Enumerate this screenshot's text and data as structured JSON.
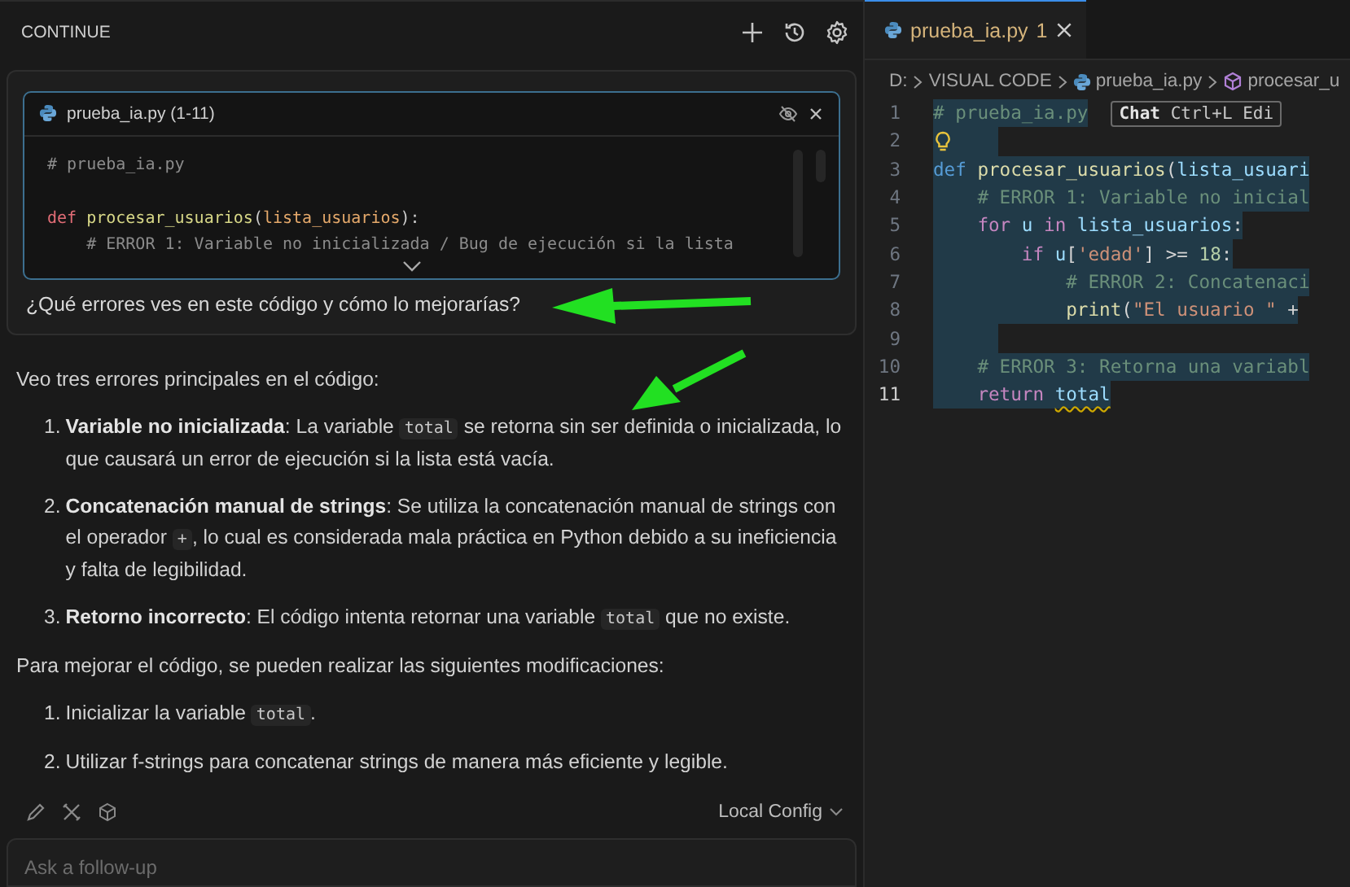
{
  "panel": {
    "title": "CONTINUE"
  },
  "context_card": {
    "file_label": "prueba_ia.py (1-11)",
    "code_lines": [
      {
        "kind": "code",
        "tokens": [
          {
            "kind": "comment",
            "text": "# prueba_ia.py"
          }
        ]
      },
      {
        "kind": "blank"
      },
      {
        "kind": "code",
        "tokens": [
          {
            "kind": "keyword",
            "text": "def"
          },
          {
            "kind": "function",
            "text": " procesar_usuarios"
          },
          {
            "kind": "plain",
            "text": "("
          },
          {
            "kind": "param",
            "text": "lista_usuarios"
          },
          {
            "kind": "plain",
            "text": "):"
          }
        ]
      },
      {
        "kind": "code",
        "tokens": [
          {
            "kind": "comment",
            "text": "    # ERROR 1: Variable no inicializada / Bug de ejecución si la lista"
          }
        ]
      }
    ],
    "question": "¿Qué errores ves en este código y cómo lo mejorarías?"
  },
  "response": [
    {
      "kind": "paragraph",
      "segments": [
        {
          "kind": "text",
          "text": "Veo tres errores principales en el código:"
        }
      ]
    },
    {
      "kind": "list",
      "items": [
        {
          "number": "1.",
          "segments": [
            {
              "kind": "bold",
              "text": "Variable no inicializada"
            },
            {
              "kind": "text",
              "text": ": La variable "
            },
            {
              "kind": "code",
              "text": "total"
            },
            {
              "kind": "text",
              "text": " se retorna sin ser definida o inicializada, lo que causará un error de ejecución si la lista está vacía."
            }
          ]
        },
        {
          "number": "2.",
          "segments": [
            {
              "kind": "bold",
              "text": "Concatenación manual de strings"
            },
            {
              "kind": "text",
              "text": ": Se utiliza la concatenación manual de strings con el operador "
            },
            {
              "kind": "code",
              "text": "+"
            },
            {
              "kind": "text",
              "text": ", lo cual es considerada mala práctica en Python debido a su ineficiencia y falta de legibilidad."
            }
          ]
        },
        {
          "number": "3.",
          "segments": [
            {
              "kind": "bold",
              "text": "Retorno incorrecto"
            },
            {
              "kind": "text",
              "text": ": El código intenta retornar una variable "
            },
            {
              "kind": "code",
              "text": "total"
            },
            {
              "kind": "text",
              "text": " que no existe."
            }
          ]
        }
      ]
    },
    {
      "kind": "paragraph",
      "segments": [
        {
          "kind": "text",
          "text": "Para mejorar el código, se pueden realizar las siguientes modificaciones:"
        }
      ]
    },
    {
      "kind": "list",
      "items": [
        {
          "number": "1.",
          "segments": [
            {
              "kind": "text",
              "text": "Inicializar la variable "
            },
            {
              "kind": "code",
              "text": "total"
            },
            {
              "kind": "text",
              "text": "."
            }
          ]
        },
        {
          "number": "2.",
          "segments": [
            {
              "kind": "text",
              "text": "Utilizar f-strings para concatenar strings de manera más eficiente y legible."
            }
          ]
        }
      ]
    }
  ],
  "footer": {
    "model_selector": "Local Config"
  },
  "follow_up": {
    "placeholder": "Ask a follow-up"
  },
  "editor": {
    "tab": {
      "filename": "prueba_ia.py",
      "problems": "1",
      "selected": true
    },
    "breadcrumb": [
      "D:",
      "VISUAL CODE",
      "prueba_ia.py",
      "procesar_u"
    ],
    "inline_hint": "**Chat** Ctrl+L Edi",
    "lines": [
      {
        "number": "1",
        "current": false,
        "selected": true,
        "tokens": [
          {
            "kind": "comment",
            "text": "# prueba_ia.py"
          }
        ]
      },
      {
        "number": "2",
        "current": false,
        "selected": true
      },
      {
        "number": "3",
        "current": false,
        "selected": true,
        "tokens": [
          {
            "kind": "keyword",
            "text": "def"
          },
          {
            "kind": "function",
            "text": " procesar_usuarios"
          },
          {
            "kind": "plain",
            "text": "("
          },
          {
            "kind": "param",
            "text": "lista_usuari"
          }
        ]
      },
      {
        "number": "4",
        "current": false,
        "selected": true,
        "tokens": [
          {
            "kind": "comment",
            "text": "    # ERROR 1: Variable no inicial"
          }
        ]
      },
      {
        "number": "5",
        "current": false,
        "selected": true,
        "tokens": [
          {
            "kind": "control",
            "text": "    for"
          },
          {
            "kind": "param",
            "text": " u"
          },
          {
            "kind": "control",
            "text": " in"
          },
          {
            "kind": "param",
            "text": " lista_usuarios"
          },
          {
            "kind": "plain",
            "text": ":"
          }
        ]
      },
      {
        "number": "6",
        "current": false,
        "selected": true,
        "tokens": [
          {
            "kind": "control",
            "text": "        if"
          },
          {
            "kind": "param",
            "text": " u"
          },
          {
            "kind": "plain",
            "text": "["
          },
          {
            "kind": "string",
            "text": "'edad'"
          },
          {
            "kind": "plain",
            "text": "] >="
          },
          {
            "kind": "number",
            "text": " 18"
          },
          {
            "kind": "plain",
            "text": ":"
          }
        ]
      },
      {
        "number": "7",
        "current": false,
        "selected": true,
        "tokens": [
          {
            "kind": "comment",
            "text": "            # ERROR 2: Concatenaci"
          }
        ]
      },
      {
        "number": "8",
        "current": false,
        "selected": true,
        "tokens": [
          {
            "kind": "function",
            "text": "            print"
          },
          {
            "kind": "plain",
            "text": "("
          },
          {
            "kind": "string",
            "text": "\"El usuario \""
          },
          {
            "kind": "plain",
            "text": " +"
          }
        ]
      },
      {
        "number": "9",
        "current": false,
        "selected": true
      },
      {
        "number": "10",
        "current": false,
        "selected": true,
        "tokens": [
          {
            "kind": "comment",
            "text": "    # ERROR 3: Retorna una variabl"
          }
        ]
      },
      {
        "number": "11",
        "current": true,
        "selected": true,
        "tokens": [
          {
            "kind": "control",
            "text": "    return "
          },
          {
            "kind": "warning",
            "text": "total"
          }
        ]
      }
    ]
  }
}
